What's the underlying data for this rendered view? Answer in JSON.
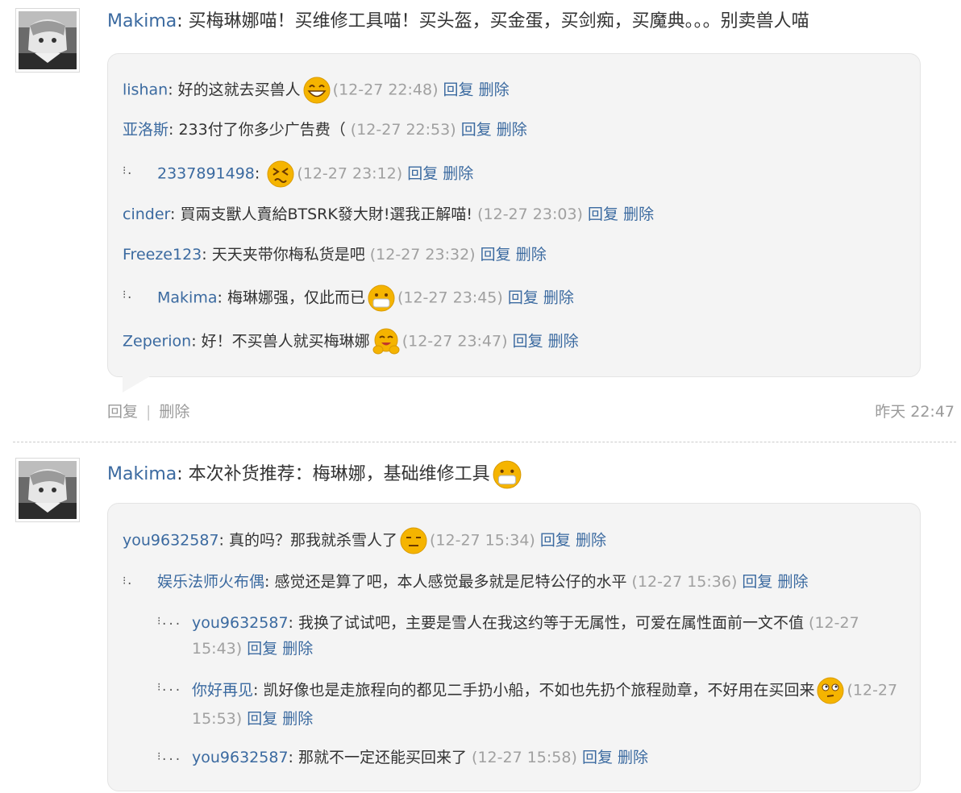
{
  "posts": [
    {
      "author": "Makima",
      "text": "买梅琳娜喵！买维修工具喵！买头盔，买金蛋，买剑痴，买魔典。。。别卖兽人喵",
      "replies": [
        {
          "user": "lishan",
          "text": "好的这就去买兽人",
          "emoji": "grin",
          "time": "(12-27 22:48)",
          "reply": "回复",
          "delete": "删除",
          "indent": 0
        },
        {
          "user": "亚洛斯",
          "text": "233付了你多少广告费（",
          "emoji": "",
          "time": "(12-27 22:53)",
          "reply": "回复",
          "delete": "删除",
          "indent": 0
        },
        {
          "user": "2337891498",
          "text": "",
          "emoji": "dizzy",
          "time": "(12-27 23:12)",
          "reply": "回复",
          "delete": "删除",
          "indent": 1
        },
        {
          "user": "cinder",
          "text": "買兩支獸人賣給BTSRK發大財!選我正解喵!",
          "emoji": "",
          "time": "(12-27 23:03)",
          "reply": "回复",
          "delete": "删除",
          "indent": 0
        },
        {
          "user": "Freeze123",
          "text": "天天夹带你梅私货是吧",
          "emoji": "",
          "time": "(12-27 23:32)",
          "reply": "回复",
          "delete": "删除",
          "indent": 0
        },
        {
          "user": "Makima",
          "text": "梅琳娜强，仅此而已",
          "emoji": "mask",
          "time": "(12-27 23:45)",
          "reply": "回复",
          "delete": "删除",
          "indent": 1
        },
        {
          "user": "Zeperion",
          "text": "好！不买兽人就买梅琳娜",
          "emoji": "hug",
          "time": "(12-27 23:47)",
          "reply": "回复",
          "delete": "删除",
          "indent": 0
        }
      ],
      "footer": {
        "reply": "回复",
        "delete": "删除",
        "time": "昨天 22:47"
      }
    },
    {
      "author": "Makima",
      "text": "本次补货推荐：梅琳娜，基础维修工具",
      "text_emoji": "mask",
      "replies": [
        {
          "user": "you9632587",
          "text": "真的吗？那我就杀雪人了",
          "emoji": "meh",
          "time": "(12-27 15:34)",
          "reply": "回复",
          "delete": "删除",
          "indent": 0
        },
        {
          "user": "娱乐法师火布偶",
          "text": "感觉还是算了吧，本人感觉最多就是尼特公仔的水平",
          "emoji": "",
          "time": "(12-27 15:36)",
          "reply": "回复",
          "delete": "删除",
          "indent": 1
        },
        {
          "user": "you9632587",
          "text": "我换了试试吧，主要是雪人在我这约等于无属性，可爱在属性面前一文不值",
          "emoji": "",
          "time": "(12-27 15:43)",
          "reply": "回复",
          "delete": "删除",
          "indent": 2
        },
        {
          "user": "你好再见",
          "text": "凯好像也是走旅程向的都见二手扔小船，不如也先扔个旅程勋章，不好用在买回来",
          "emoji": "thinking",
          "time": "(12-27 15:53)",
          "reply": "回复",
          "delete": "删除",
          "indent": 2
        },
        {
          "user": "you9632587",
          "text": "那就不一定还能买回来了",
          "emoji": "",
          "time": "(12-27 15:58)",
          "reply": "回复",
          "delete": "删除",
          "indent": 2
        }
      ]
    }
  ],
  "colors": {
    "link": "#3b6aa0",
    "time": "#a0a0a0",
    "box": "#f4f4f4",
    "emoji": "#f5b400"
  }
}
